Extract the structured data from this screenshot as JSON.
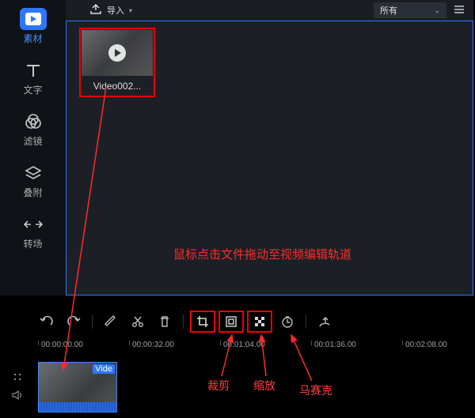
{
  "topbar": {
    "import_label": "导入",
    "filter_selected": "所有"
  },
  "side": {
    "items": [
      {
        "label": "素材",
        "icon": "play-rect-icon"
      },
      {
        "label": "文字",
        "icon": "text-icon"
      },
      {
        "label": "滤镜",
        "icon": "venn-icon"
      },
      {
        "label": "叠附",
        "icon": "layers-icon"
      },
      {
        "label": "转场",
        "icon": "transition-icon"
      }
    ]
  },
  "media": {
    "items": [
      {
        "name": "Video002..."
      }
    ]
  },
  "toolbar": {
    "buttons": [
      {
        "name": "undo-button",
        "key": "undo"
      },
      {
        "name": "redo-button",
        "key": "redo"
      },
      {
        "name": "edit-button",
        "key": "edit"
      },
      {
        "name": "cut-button",
        "key": "cut"
      },
      {
        "name": "delete-button",
        "key": "delete"
      },
      {
        "name": "crop-button",
        "key": "crop"
      },
      {
        "name": "zoom-button",
        "key": "zoom"
      },
      {
        "name": "mosaic-button",
        "key": "mosaic"
      },
      {
        "name": "duration-button",
        "key": "duration"
      },
      {
        "name": "export-button",
        "key": "export"
      }
    ]
  },
  "ruler": {
    "ticks": [
      "00:00:00.00",
      "00:00:32.00",
      "00:01:04.00",
      "00:01:36.00",
      "00:02:08.00"
    ]
  },
  "clip": {
    "label": "Vide"
  },
  "annotations": {
    "drag_hint": "鼠标点击文件拖动至视频编辑轨道",
    "crop": "裁剪",
    "zoom": "缩放",
    "mosaic": "马赛克"
  },
  "colors": {
    "accent": "#2e75ff",
    "highlight": "#e00000"
  }
}
